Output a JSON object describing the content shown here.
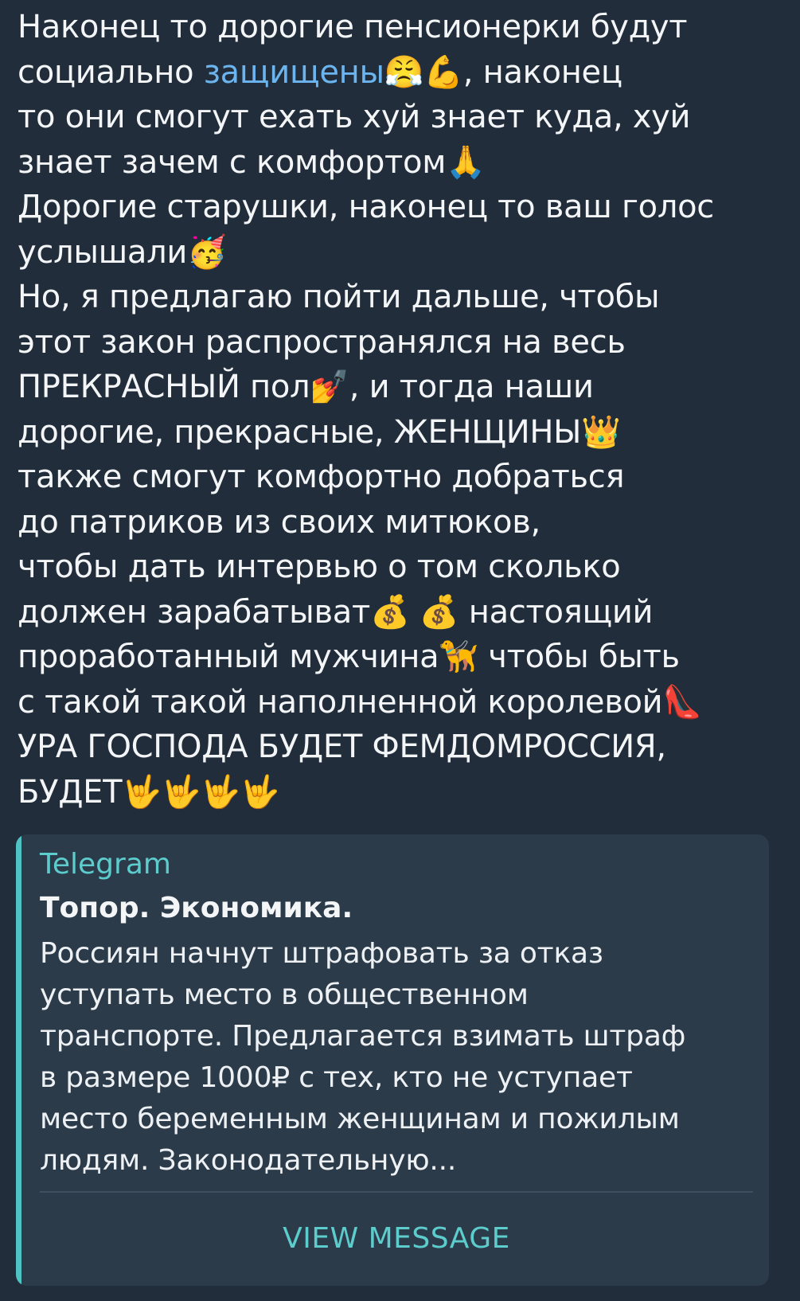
{
  "message": {
    "segments": [
      {
        "text": "Наконец то дорогие пенсионерки будут\nсоциально ",
        "link": false
      },
      {
        "text": "защищены",
        "link": true
      },
      {
        "text": "😤💪, наконец\nто они смогут ехать хуй знает куда, хуй\nзнает зачем с комфортом🙏\nДорогие старушки, наконец то ваш голос\nуслышали🥳\nНо, я предлагаю пойти дальше, чтобы\nэтот закон распространялся на весь\nПРЕКРАСНЫЙ пол💅, и тогда наши\nдорогие, прекрасные, ЖЕНЩИНЫ👑\nтакже смогут комфортно добраться\nдо патриков из своих митюков,\nчтобы дать интервью о том сколько\nдолжен зарабатыват💰 💰 настоящий\nпроработанный мужчина🦮 чтобы быть\nс такой такой наполненной королевой👠\nУРА ГОСПОДА БУДЕТ ФЕМДОМРОССИЯ,\nБУДЕТ🤟🤟🤟🤟",
        "link": false
      }
    ],
    "link_color": "#6cb4ee"
  },
  "forward_card": {
    "source": "Telegram",
    "title": "Топор. Экономика.",
    "text": "Россиян начнут штрафовать за отказ\nуступать место в общественном\nтранспорте. Предлагается взимать штраф\nв размере 1000₽ с тех, кто не уступает\nместо беременным женщинам и пожилым\nлюдям. Законодательную...",
    "button_label": "VIEW MESSAGE",
    "accent_color": "#4fc3c3"
  },
  "colors": {
    "background": "#212d3b",
    "card_background": "#2c3b4a",
    "text": "#f3f5f7"
  }
}
